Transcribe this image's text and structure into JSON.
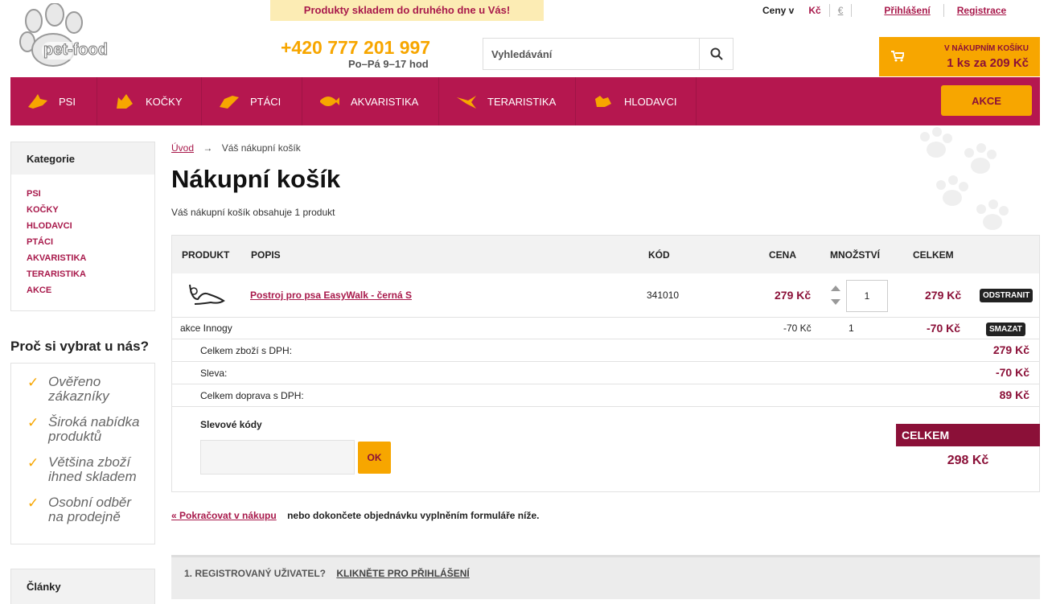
{
  "header": {
    "promo": "Produkty skladem do druhého dne u Vás!",
    "prices_label": "Ceny v",
    "currency_czk": "Kč",
    "currency_eur": "€",
    "login": "Přihlášení",
    "register": "Registrace",
    "logo_text": "pet-food",
    "phone": "+420 777 201 997",
    "hours": "Po–Pá 9–17 hod",
    "search_placeholder": "Vyhledávání",
    "cart_label": "V NÁKUPNÍM KOŠÍKU",
    "cart_summary": "1 ks za 209 Kč"
  },
  "nav": {
    "items": [
      "PSI",
      "KOČKY",
      "PTÁCI",
      "AKVARISTIKA",
      "TERARISTIKA",
      "HLODAVCI"
    ],
    "akce": "AKCE"
  },
  "sidebar": {
    "category_title": "Kategorie",
    "categories": [
      "PSI",
      "KOČKY",
      "HLODAVCI",
      "PTÁCI",
      "AKVARISTIKA",
      "TERARISTIKA",
      "AKCE"
    ],
    "why_title": "Proč si vybrat u nás?",
    "reasons": [
      "Ověřeno zákazníky",
      "Široká nabídka produktů",
      "Většina zboží ihned skladem",
      "Osobní odběr na prodejně"
    ],
    "articles_title": "Články"
  },
  "breadcrumb": {
    "home": "Úvod",
    "arrow": "→",
    "current": "Váš nákupní košík"
  },
  "page": {
    "title": "Nákupní košík",
    "subtitle": "Váš nákupní košík obsahuje 1 produkt"
  },
  "table": {
    "headers": {
      "product": "PRODUKT",
      "desc": "POPIS",
      "code": "KÓD",
      "price": "CENA",
      "qty": "MNOŽSTVÍ",
      "total": "CELKEM"
    },
    "item": {
      "name": "Postroj pro psa EasyWalk - černá S",
      "code": "341010",
      "price": "279 Kč",
      "qty": "1",
      "total": "279 Kč",
      "remove": "ODSTRANIT"
    },
    "discount": {
      "name": "akce Innogy",
      "price": "-70 Kč",
      "qty": "1",
      "total": "-70 Kč",
      "delete": "SMAZAT"
    },
    "summary": [
      {
        "label": "Celkem zboží s DPH:",
        "value": "279 Kč"
      },
      {
        "label": "Sleva:",
        "value": "-70 Kč"
      },
      {
        "label": "Celkem doprava s DPH:",
        "value": "89 Kč"
      }
    ],
    "coupon_title": "Slevové kódy",
    "coupon_ok": "OK",
    "grand_label": "CELKEM",
    "grand_value": "298 Kč"
  },
  "continue": {
    "link": "« Pokračovat v nákupu",
    "text": "nebo dokončete objednávku vyplněním formuláře níže."
  },
  "registration": {
    "label": "1. REGISTROVANÝ UŽIVATEL?",
    "link": "KLIKNĚTE PRO PŘIHLÁŠENÍ"
  },
  "colors": {
    "brand": "#b5174f",
    "accent": "#f7a600",
    "dark_brand": "#8b1038"
  }
}
